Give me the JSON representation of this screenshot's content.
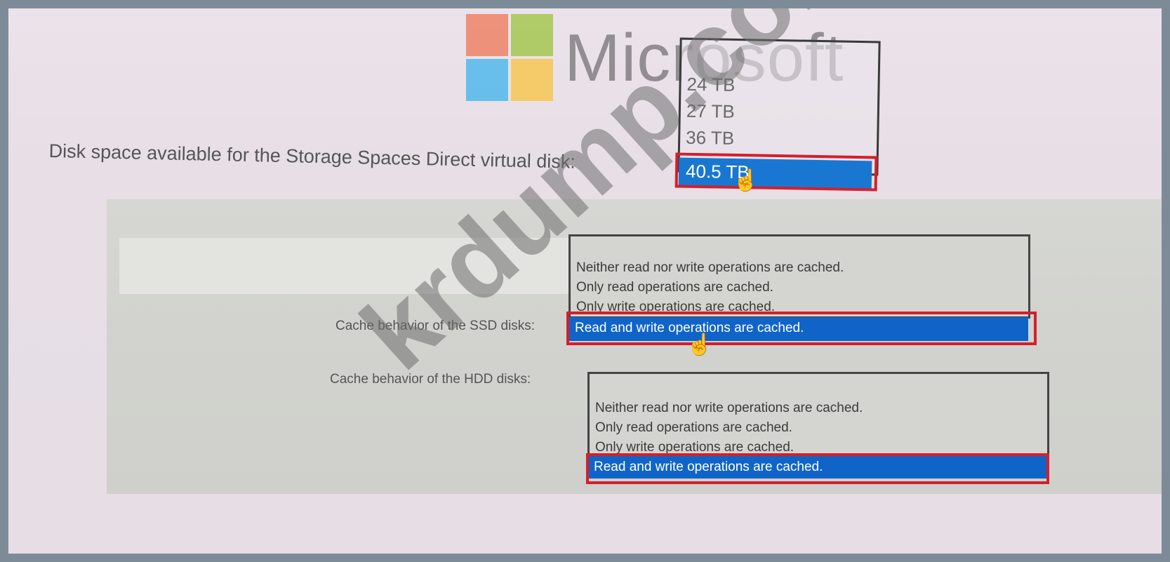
{
  "logo": {
    "word": "Microsoft"
  },
  "watermark": {
    "text": "krdump.com"
  },
  "disk_question": {
    "label": "Disk space available for the Storage Spaces Direct virtual disk:",
    "options": [
      "24 TB",
      "27 TB",
      "36 TB"
    ],
    "selected": "40.5 TB"
  },
  "ssd_question": {
    "label": "Cache behavior of the SSD disks:",
    "options": [
      "Neither read nor write operations are cached.",
      "Only read operations are cached.",
      "Only write operations are cached."
    ],
    "selected": "Read and write operations are cached."
  },
  "hdd_question": {
    "label": "Cache behavior of the HDD disks:",
    "options": [
      "Neither read nor write operations are cached.",
      "Only read operations are cached.",
      "Only write operations are cached."
    ],
    "selected": "Read and write operations are cached."
  },
  "colors": {
    "selection": "#1064c8",
    "highlight_border": "#d41f2b",
    "background": "#e7dee6",
    "panel": "#d2d3ce"
  }
}
